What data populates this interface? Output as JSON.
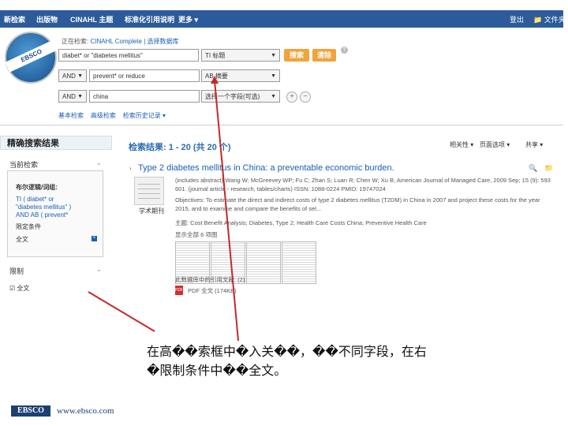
{
  "nav": {
    "items": [
      "新检索",
      "出版物",
      "CINAHL 主题",
      "标准化引用说明",
      "更多 ▾"
    ],
    "signin": "登出",
    "folder": "文件夹"
  },
  "logo": {
    "text": "EBSCO"
  },
  "breadcrumb": {
    "prefix": "正在检索:",
    "db": "CINAHL Complete",
    "choose": "选择数据库"
  },
  "search": {
    "rows": [
      {
        "op": "",
        "term": "diabet* or \"diabetes mellitus\"",
        "field": "TI 标题"
      },
      {
        "op": "AND",
        "term": "prevent* or reduce",
        "field": "AB 摘要"
      },
      {
        "op": "AND",
        "term": "china",
        "field": "选择一个字段(可选)"
      }
    ],
    "search_btn": "搜索",
    "clear_btn": "清除",
    "help": "?"
  },
  "links": {
    "basic": "基本检索",
    "advanced": "高级检索",
    "history": "检索历史记录 ▾"
  },
  "left": {
    "header": "精确搜索结果",
    "current": "当前检索",
    "boolean_label": "布尔逻辑/词组:",
    "query": "TI ( diabet* or \"diabetes mellitus\" ) AND AB ( prevent*",
    "limit_label": "限定条件",
    "fulltext": "全文",
    "limit_head": "限制",
    "fulltext2": "全文"
  },
  "results": {
    "header": "检索结果: 1 - 20 (共 20 个)",
    "sort": "相关性 ▾",
    "page_options": "页面选项 ▾",
    "share": "共享 ▾",
    "item": {
      "title": "Type 2 diabetes mellitus in China: a preventable economic burden.",
      "type_label": "学术期刊",
      "meta1": "(includes abstract) Wang W; McGreevey WP; Fu C; Zhan S; Luan R; Chen W; Xu B; American Journal of Managed Care, 2009 Sep; 15 (9): 593",
      "meta2": "601. (journal article - research, tables/charts) ISSN: 1088-0224 PMID: 19747024",
      "meta3": "Objectives: To estimate the direct and indirect costs of type 2 diabetes mellitus (T2DM) in China in 2007 and project these costs for the year",
      "meta4": "2015, and to examine and compare the benefits of sel...",
      "subjects": "主题: Cost Benefit Analysis; Diabetes, Type 2; Health Care Costs China; Preventive Health Care",
      "show_all": "显示全部 6 项图",
      "cited": "此数据库中的引用文献: (2)",
      "pdf": "PDF 全文 (174KB)"
    }
  },
  "caption": {
    "line1": "在高��索框中�入关��，��不同字段，在右",
    "line2": "�限制条件中��全文。"
  },
  "footer": {
    "logo": "EBSCO",
    "url": "www.ebsco.com"
  },
  "colors": {
    "nav": "#2b5b9a",
    "button": "#f2a33a",
    "link": "#1a5fb4",
    "arrow": "#c62828"
  }
}
